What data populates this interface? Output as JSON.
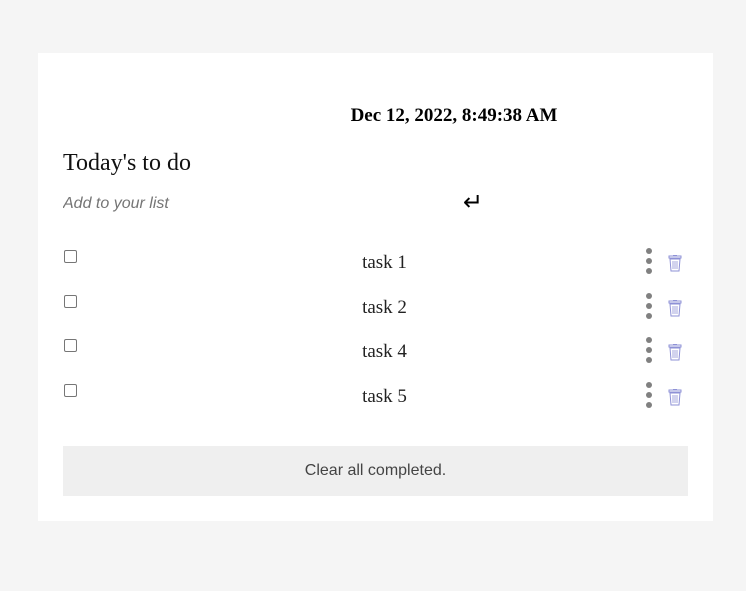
{
  "header": {
    "datetime": "Dec 12, 2022, 8:49:38 AM",
    "title": "Today's to do"
  },
  "add": {
    "placeholder": "Add to your list",
    "enter_glyph": "↵",
    "enter_icon": "enter-return-icon"
  },
  "tasks": [
    {
      "label": "task 1",
      "checked": false
    },
    {
      "label": "task 2",
      "checked": false
    },
    {
      "label": "task 4",
      "checked": false
    },
    {
      "label": "task 5",
      "checked": false
    }
  ],
  "icons": {
    "more": "vertical-ellipsis-icon",
    "delete": "trash-icon"
  },
  "colors": {
    "page_bg": "#f5f5f5",
    "card_bg": "#ffffff",
    "trash": "#8e91d6",
    "kebab": "#808080",
    "clear_bg": "#efefef"
  },
  "footer": {
    "clear_label": "Clear all completed."
  }
}
